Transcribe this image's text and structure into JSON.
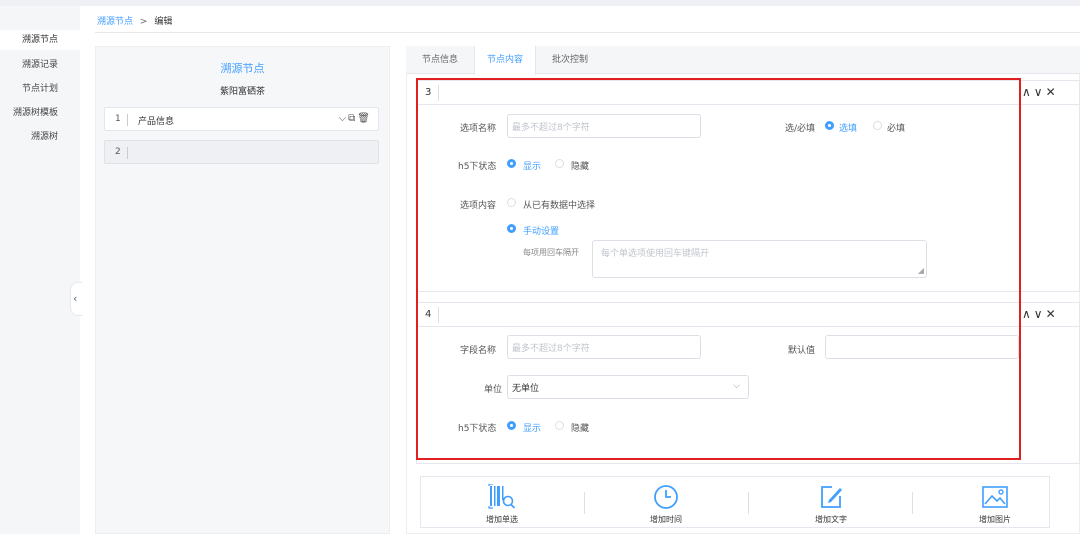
{
  "breadcrumb": {
    "parent": "溯源节点",
    "sep": ">",
    "current": "编辑"
  },
  "sidebar": {
    "items": [
      {
        "label": "溯源节点"
      },
      {
        "label": "溯源记录"
      },
      {
        "label": "节点计划"
      },
      {
        "label": "溯源树模板"
      },
      {
        "label": "溯源树"
      }
    ]
  },
  "left_panel": {
    "title": "溯源节点",
    "subtitle": "紫阳富硒茶",
    "nodes": [
      {
        "num": "1",
        "label": "产品信息"
      },
      {
        "num": "2",
        "label": ""
      }
    ]
  },
  "tabs": [
    {
      "label": "节点信息"
    },
    {
      "label": "节点内容"
    },
    {
      "label": "批次控制"
    }
  ],
  "block3": {
    "num": "3",
    "option_name_label": "选项名称",
    "option_name_placeholder": "最多不超过8个字符",
    "required_label": "选/必填",
    "required_options": [
      "选填",
      "必填"
    ],
    "h5_label": "h5下状态",
    "h5_options": [
      "显示",
      "隐藏"
    ],
    "content_label": "选项内容",
    "content_options": [
      "从已有数据中选择",
      "手动设置"
    ],
    "split_label": "每项用回车隔开",
    "split_placeholder": "每个单选项使用回车键隔开"
  },
  "block4": {
    "num": "4",
    "field_name_label": "字段名称",
    "field_name_placeholder": "最多不超过8个字符",
    "default_label": "默认值",
    "unit_label": "单位",
    "unit_value": "无单位",
    "h5_label": "h5下状态",
    "h5_options": [
      "显示",
      "隐藏"
    ]
  },
  "toolbar": {
    "items": [
      {
        "label": "增加单选",
        "icon": "barcode-search-icon"
      },
      {
        "label": "增加时间",
        "icon": "clock-icon"
      },
      {
        "label": "增加文字",
        "icon": "edit-icon"
      },
      {
        "label": "增加图片",
        "icon": "image-icon"
      }
    ]
  },
  "colors": {
    "accent": "#409eff",
    "highlight": "#e02020"
  }
}
